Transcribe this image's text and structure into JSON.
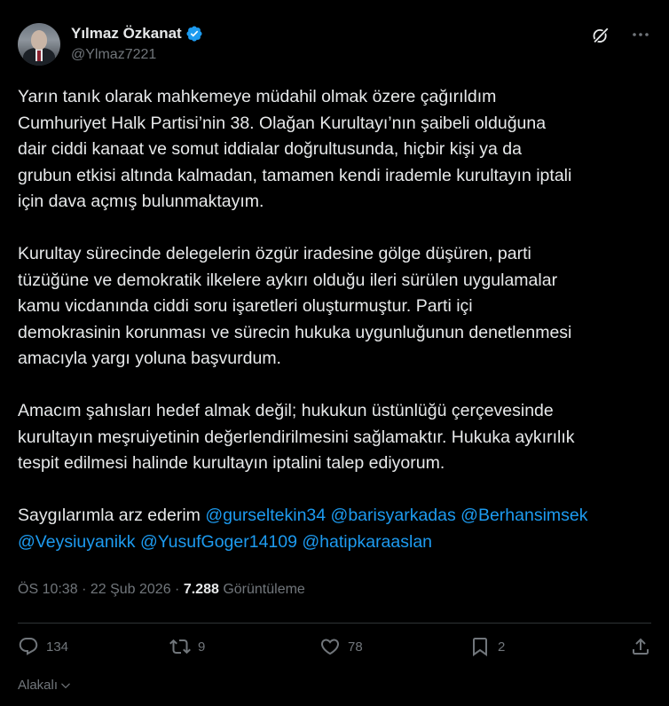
{
  "author": {
    "name": "Yılmaz Özkanat",
    "handle": "@Ylmaz7221"
  },
  "tweet": {
    "paragraph1": "Yarın tanık olarak mahkemeye müdahil olmak özere çağırıldım\nCumhuriyet Halk Partisi’nin 38. Olağan Kurultayı’nın şaibeli olduğuna\ndair ciddi kanaat ve somut iddialar doğrultusunda, hiçbir kişi ya da\ngrubun etkisi altında kalmadan, tamamen kendi irademle kurultayın iptali\niçin dava açmış bulunmaktayım.",
    "paragraph2": "Kurultay sürecinde delegelerin özgür iradesine gölge düşüren, parti\ntüzüğüne ve demokratik ilkelere aykırı olduğu ileri sürülen uygulamalar\nkamu vicdanında ciddi soru işaretleri oluşturmuştur. Parti içi\ndemokrasinin korunması ve sürecin hukuka uygunluğunun denetlenmesi\namacıyla yargı yoluna başvurdum.",
    "paragraph3": "Amacım şahısları hedef almak değil; hukukun üstünlüğü çerçevesinde\nkurultayın meşruiyetinin değerlendirilmesini sağlamaktır. Hukuka aykırılık\ntespit edilmesi halinde kurultayın iptalini talep ediyorum.",
    "closing": "Saygılarımla arz ederim",
    "mentions": [
      "@gurseltekin34",
      "@barisyarkadas",
      "@Berhansimsek",
      "@Veysiuyanikk",
      "@YusufGoger14109",
      "@hatipkaraaslan"
    ]
  },
  "meta": {
    "time": "ÖS 10:38",
    "separator1": "·",
    "date": "22 Şub 2026",
    "separator2": "·",
    "views_count": "7.288",
    "views_label": "Görüntüleme"
  },
  "actions": {
    "replies": "134",
    "reposts": "9",
    "likes": "78",
    "bookmarks": "2"
  },
  "filter": {
    "label": "Alakalı"
  },
  "colors": {
    "background": "#000000",
    "text": "#e7e9ea",
    "secondary": "#71767b",
    "accent": "#1d9bf0",
    "divider": "#2f3336"
  },
  "icons": [
    "verified-badge-icon",
    "grok-icon",
    "more-icon",
    "reply-icon",
    "repost-icon",
    "like-icon",
    "bookmark-icon",
    "share-icon",
    "chevron-down-icon"
  ]
}
